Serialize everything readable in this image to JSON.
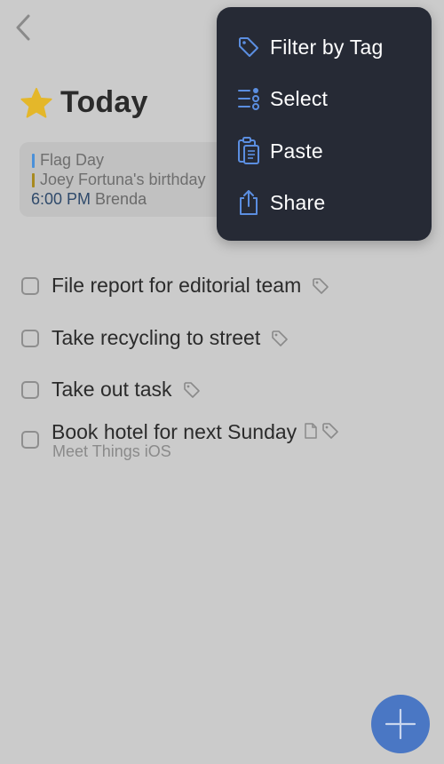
{
  "header": {
    "title": "Today"
  },
  "events": [
    {
      "text": "Flag Day",
      "color": "#4a90d9"
    },
    {
      "text": "Joey Fortuna's birthday",
      "color": "#a88a1f"
    },
    {
      "time": "6:00 PM",
      "text": "Brenda"
    }
  ],
  "tasks": [
    {
      "title": "File report for editorial team"
    },
    {
      "title": "Take recycling to street"
    },
    {
      "title": "Take out task"
    },
    {
      "title": "Book hotel for next Sunday",
      "subtitle": "Meet Things iOS"
    }
  ],
  "menu": {
    "items": [
      {
        "label": "Filter by Tag",
        "icon": "tag-icon"
      },
      {
        "label": "Select",
        "icon": "select-list-icon"
      },
      {
        "label": "Paste",
        "icon": "clipboard-icon"
      },
      {
        "label": "Share",
        "icon": "share-icon"
      }
    ]
  },
  "colors": {
    "background": "#cbcbcb",
    "menu_bg": "#262a35",
    "accent": "#4a77c4",
    "star": "#e4b72a"
  }
}
